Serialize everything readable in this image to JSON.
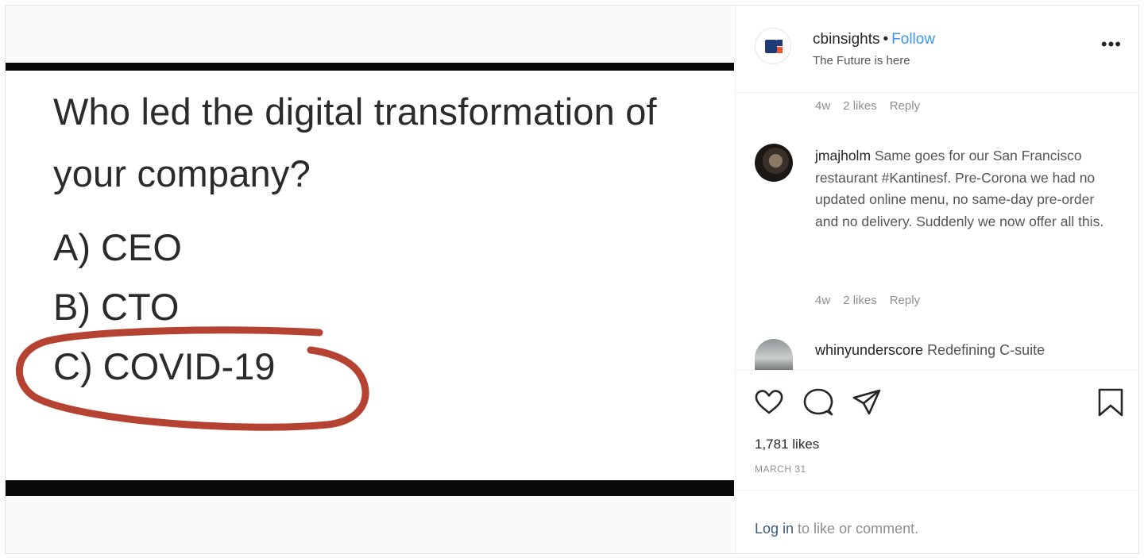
{
  "slide": {
    "question_line1": "Who led the digital transformation of",
    "question_line2": "your company?",
    "option_a": "A) CEO",
    "option_b": "B) CTO",
    "option_c": "C) COVID-19",
    "circle_color": "#b0321f"
  },
  "header": {
    "username": "cbinsights",
    "separator": "•",
    "follow_label": "Follow",
    "subtitle": "The Future is here",
    "more_label": "•••",
    "logo_icon": "cbinsights-logo-icon"
  },
  "comments": [
    {
      "meta": {
        "age": "4w",
        "likes": "2 likes",
        "reply": "Reply"
      }
    },
    {
      "user": "jmajholm",
      "text": "Same goes for our San Francisco restaurant #Kantinesf. Pre-Corona we had no updated online menu, no same-day pre-order and no delivery. Suddenly we now offer all this.",
      "meta": {
        "age": "4w",
        "likes": "2 likes",
        "reply": "Reply"
      }
    },
    {
      "user": "whinyunderscore",
      "text": "Redefining C-suite"
    }
  ],
  "actions": {
    "like_icon": "heart-icon",
    "comment_icon": "comment-icon",
    "share_icon": "paper-plane-icon",
    "save_icon": "bookmark-icon",
    "likes_count": "1,781 likes",
    "date": "MARCH 31"
  },
  "login": {
    "link": "Log in",
    "rest": " to like or comment."
  },
  "colors": {
    "follow": "#3897f0",
    "muted": "#8e8e8e",
    "text": "#262626"
  }
}
